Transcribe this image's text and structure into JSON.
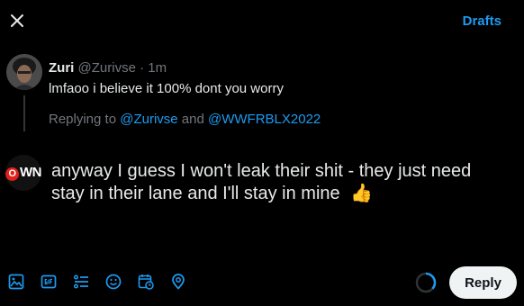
{
  "header": {
    "close_icon": "close-icon",
    "drafts_label": "Drafts"
  },
  "parent_tweet": {
    "display_name": "Zuri",
    "handle": "@Zurivse",
    "separator": " · ",
    "time": "1m",
    "text": "lmfaoo i believe it 100% dont you worry"
  },
  "replying_to": {
    "prefix": "Replying to ",
    "user1": "@Zurivse",
    "conjunction": " and ",
    "user2": "@WWFRBLX2022"
  },
  "composer": {
    "avatar_text": "OWN",
    "text": "anyway I guess I won't leak their shit - they just need stay in their lane and I'll stay in mine",
    "emoji": "👍"
  },
  "toolbar": {
    "icons": [
      "image-icon",
      "gif-icon",
      "poll-icon",
      "emoji-icon",
      "schedule-icon",
      "location-icon"
    ],
    "reply_label": "Reply"
  },
  "colors": {
    "accent": "#1d9bf0",
    "background": "#000000",
    "text": "#e7e9ea",
    "muted": "#71767b",
    "reply_button_bg": "#eff3f4"
  }
}
